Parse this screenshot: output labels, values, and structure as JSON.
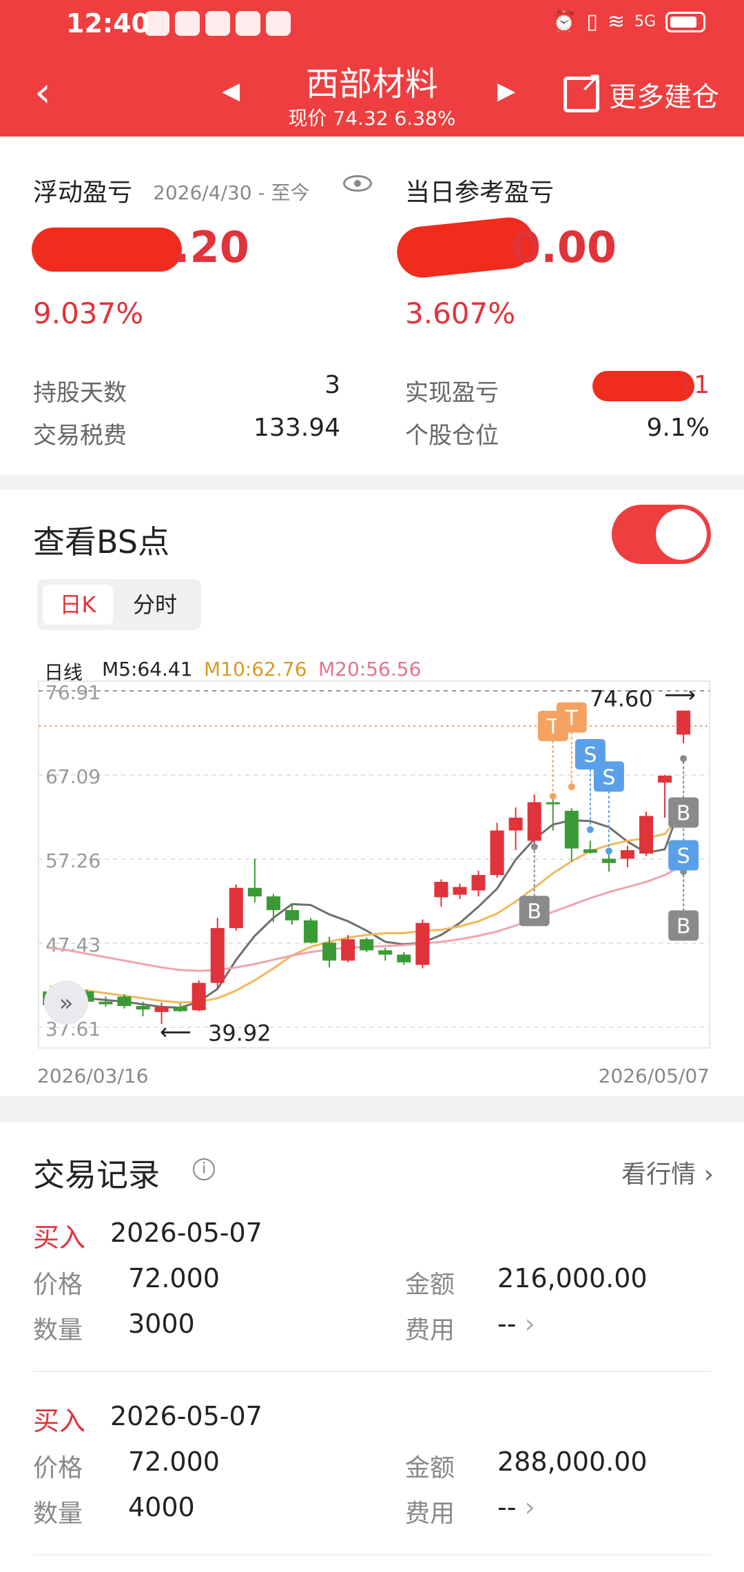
{
  "status": {
    "time": "12:40",
    "network": "5G"
  },
  "header": {
    "title": "西部材料",
    "price_label": "现价 74.32 6.38%",
    "more_label": "更多建仓"
  },
  "summary": {
    "float_label": "浮动盈亏",
    "float_since": "2026/4/30 - 至今",
    "float_value_suffix": ".20",
    "float_pct": "9.037%",
    "daily_label": "当日参考盈亏",
    "daily_value_suffix": "0.00",
    "daily_pct": "3.607%",
    "hold_days_label": "持股天数",
    "hold_days": "3",
    "fee_label": "交易税费",
    "fee": "133.94",
    "realized_label": "实现盈亏",
    "realized_suffix": "11",
    "position_label": "个股仓位",
    "position": "9.1%"
  },
  "bs": {
    "title": "查看BS点",
    "toggle_on": true,
    "tabs": [
      "日K",
      "分时"
    ],
    "active_tab": "日K",
    "ma_label": "日线",
    "m5": "M5:64.41",
    "m10": "M10:62.76",
    "m20": "M20:56.56"
  },
  "colors": {
    "up": "#e0333a",
    "down": "#3a9a34",
    "m5": "#6e6e6e",
    "m10": "#f0b85a",
    "m20": "#f0a3ae",
    "t_badge": "#f4a261",
    "s_badge": "#5aa0e8",
    "b_badge": "#8a8a8a"
  },
  "chart_data": {
    "type": "candlestick",
    "x_start": "2026/03/16",
    "x_end": "2026/05/07",
    "y_ticks": [
      "76.91",
      "67.09",
      "57.26",
      "47.43",
      "37.61"
    ],
    "ylim": [
      37.61,
      76.91
    ],
    "max_label": "74.60",
    "min_label": "39.92",
    "candles": [
      {
        "o": 41.8,
        "h": 42.0,
        "l": 39.5,
        "c": 40.2
      },
      {
        "o": 40.5,
        "h": 42.0,
        "l": 40.2,
        "c": 41.8
      },
      {
        "o": 41.8,
        "h": 42.0,
        "l": 40.5,
        "c": 40.6
      },
      {
        "o": 40.6,
        "h": 41.2,
        "l": 40.0,
        "c": 40.3
      },
      {
        "o": 41.2,
        "h": 41.5,
        "l": 39.8,
        "c": 40.1
      },
      {
        "o": 40.1,
        "h": 40.6,
        "l": 38.9,
        "c": 39.7
      },
      {
        "o": 39.4,
        "h": 40.5,
        "l": 38.0,
        "c": 40.0
      },
      {
        "o": 40.0,
        "h": 40.4,
        "l": 39.4,
        "c": 39.5
      },
      {
        "o": 39.6,
        "h": 43.1,
        "l": 39.5,
        "c": 42.8
      },
      {
        "o": 42.8,
        "h": 50.4,
        "l": 42.2,
        "c": 49.2
      },
      {
        "o": 49.2,
        "h": 54.3,
        "l": 48.9,
        "c": 53.9
      },
      {
        "o": 53.9,
        "h": 57.3,
        "l": 52.2,
        "c": 52.9
      },
      {
        "o": 52.9,
        "h": 53.2,
        "l": 49.9,
        "c": 51.3
      },
      {
        "o": 51.3,
        "h": 52.1,
        "l": 49.6,
        "c": 50.1
      },
      {
        "o": 50.1,
        "h": 50.4,
        "l": 47.4,
        "c": 47.5
      },
      {
        "o": 47.5,
        "h": 48.2,
        "l": 44.6,
        "c": 45.4
      },
      {
        "o": 45.4,
        "h": 48.4,
        "l": 45.2,
        "c": 47.9
      },
      {
        "o": 47.9,
        "h": 48.1,
        "l": 46.4,
        "c": 46.6
      },
      {
        "o": 46.6,
        "h": 46.9,
        "l": 45.4,
        "c": 46.1
      },
      {
        "o": 46.1,
        "h": 46.4,
        "l": 44.9,
        "c": 45.2
      },
      {
        "o": 44.9,
        "h": 50.2,
        "l": 44.5,
        "c": 49.8
      },
      {
        "o": 52.8,
        "h": 54.9,
        "l": 51.7,
        "c": 54.6
      },
      {
        "o": 53.1,
        "h": 54.4,
        "l": 52.6,
        "c": 54.0
      },
      {
        "o": 53.6,
        "h": 55.9,
        "l": 52.9,
        "c": 55.4
      },
      {
        "o": 55.4,
        "h": 61.5,
        "l": 55.1,
        "c": 60.6
      },
      {
        "o": 60.6,
        "h": 63.3,
        "l": 58.3,
        "c": 62.1
      },
      {
        "o": 59.4,
        "h": 64.8,
        "l": 58.7,
        "c": 63.9
      },
      {
        "o": 63.9,
        "h": 64.4,
        "l": 60.6,
        "c": 63.7
      },
      {
        "o": 62.9,
        "h": 63.2,
        "l": 57.0,
        "c": 58.5
      },
      {
        "o": 58.4,
        "h": 59.4,
        "l": 57.9,
        "c": 58.0
      },
      {
        "o": 57.3,
        "h": 58.2,
        "l": 55.8,
        "c": 56.8
      },
      {
        "o": 57.3,
        "h": 58.8,
        "l": 56.3,
        "c": 58.3
      },
      {
        "o": 57.9,
        "h": 62.8,
        "l": 57.6,
        "c": 62.3
      },
      {
        "o": 66.2,
        "h": 67.1,
        "l": 62.1,
        "c": 67.0
      },
      {
        "o": 71.8,
        "h": 74.6,
        "l": 70.8,
        "c": 74.6
      }
    ],
    "series": [
      {
        "name": "M5",
        "values": [
          41.0,
          41.2,
          41.0,
          40.8,
          40.6,
          40.3,
          40.0,
          39.9,
          40.6,
          42.1,
          45.5,
          48.3,
          50.4,
          52.0,
          51.9,
          50.8,
          50.0,
          48.9,
          47.6,
          47.3,
          47.5,
          48.4,
          49.8,
          51.7,
          53.8,
          57.2,
          59.6,
          61.3,
          61.8,
          61.7,
          61.0,
          59.3,
          58.0,
          58.4,
          64.4
        ]
      },
      {
        "name": "M10",
        "values": [
          42.4,
          42.2,
          41.9,
          41.6,
          41.3,
          41.0,
          40.7,
          40.5,
          40.6,
          41.0,
          41.9,
          43.1,
          44.5,
          46.0,
          47.0,
          47.6,
          48.1,
          48.4,
          48.6,
          48.6,
          48.9,
          49.0,
          49.4,
          50.0,
          50.9,
          52.3,
          53.9,
          55.6,
          57.0,
          58.2,
          58.9,
          59.4,
          59.7,
          60.2,
          62.8
        ]
      },
      {
        "name": "M20",
        "values": [
          46.9,
          46.6,
          46.2,
          45.8,
          45.4,
          45.0,
          44.6,
          44.3,
          44.2,
          44.3,
          44.6,
          45.0,
          45.5,
          46.0,
          46.4,
          46.7,
          46.9,
          47.0,
          47.1,
          47.2,
          47.4,
          47.6,
          47.9,
          48.3,
          48.8,
          49.5,
          50.3,
          51.1,
          51.9,
          52.7,
          53.4,
          54.0,
          54.6,
          55.4,
          56.6
        ]
      }
    ],
    "markers": [
      {
        "label": "T",
        "i": 27,
        "y": 72.8,
        "at": 64.6
      },
      {
        "label": "T",
        "i": 28,
        "y": 73.8,
        "at": 65.7
      },
      {
        "label": "S",
        "i": 29,
        "y": 69.5,
        "at": 60.7
      },
      {
        "label": "S",
        "i": 30,
        "y": 66.9,
        "at": 58.2
      },
      {
        "label": "B",
        "i": 26,
        "y": 51.2,
        "at": 58.7
      },
      {
        "label": "B",
        "i": 35,
        "y": 49.5,
        "at": 55.8
      },
      {
        "label": "S",
        "i": 35,
        "y": 57.7,
        "at": 61.9
      },
      {
        "label": "B",
        "i": 36,
        "y": 62.7,
        "at": 69.0
      }
    ]
  },
  "trades": {
    "title": "交易记录",
    "market_link": "看行情",
    "price_label": "价格",
    "qty_label": "数量",
    "amount_label": "金额",
    "fee_label": "费用",
    "items": [
      {
        "type": "买入",
        "date": "2026-05-07",
        "price": "72.000",
        "qty": "3000",
        "amount": "216,000.00",
        "fee": "--"
      },
      {
        "type": "买入",
        "date": "2026-05-07",
        "price": "72.000",
        "qty": "4000",
        "amount": "288,000.00",
        "fee": "--"
      }
    ]
  }
}
